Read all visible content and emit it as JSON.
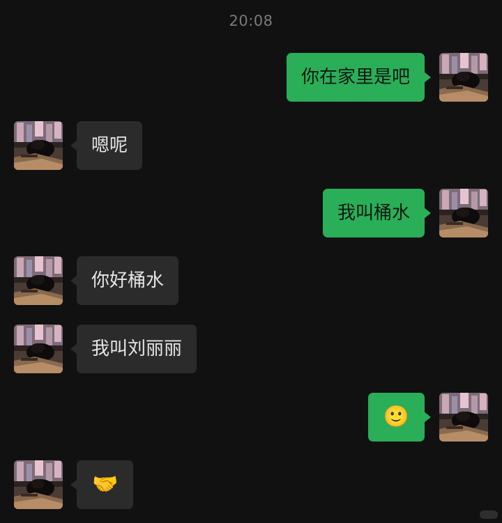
{
  "chat": {
    "timestamp": "20:08",
    "messages": [
      {
        "direction": "out",
        "text": "你在家里是吧"
      },
      {
        "direction": "in",
        "text": "嗯呢"
      },
      {
        "direction": "out",
        "text": "我叫桶水"
      },
      {
        "direction": "in",
        "text": "你好桶水"
      },
      {
        "direction": "in",
        "text": "我叫刘丽丽"
      },
      {
        "direction": "out",
        "text": "🙂",
        "icon": "smile-emoji"
      },
      {
        "direction": "in",
        "text": "🤝",
        "icon": "handshake-emoji"
      }
    ]
  },
  "colors": {
    "background": "#111111",
    "outgoing_bubble": "#2aae58",
    "incoming_bubble": "#2b2b2b",
    "timestamp_text": "#7a7a7a"
  }
}
